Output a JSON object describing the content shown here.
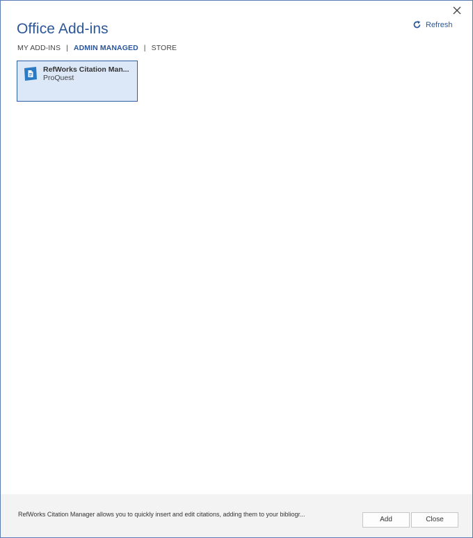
{
  "dialog": {
    "title": "Office Add-ins",
    "refresh_label": "Refresh",
    "close_icon": "close-icon",
    "refresh_icon": "refresh-icon"
  },
  "tabs": [
    {
      "label": "MY ADD-INS",
      "active": false
    },
    {
      "label": "ADMIN MANAGED",
      "active": true
    },
    {
      "label": "STORE",
      "active": false
    }
  ],
  "tab_separator": "|",
  "addins": [
    {
      "name": "RefWorks Citation Man...",
      "publisher": "ProQuest",
      "icon": "document-icon",
      "selected": true
    }
  ],
  "footer": {
    "description": "RefWorks Citation Manager allows you to quickly insert and edit citations, adding them to your bibliogr...",
    "add_label": "Add",
    "close_label": "Close"
  },
  "colors": {
    "accent": "#2b579a",
    "selected_bg": "#dce8f8",
    "selected_border": "#2e5ea6",
    "icon_blue": "#2a7ac4",
    "footer_bg": "#f3f3f3"
  }
}
